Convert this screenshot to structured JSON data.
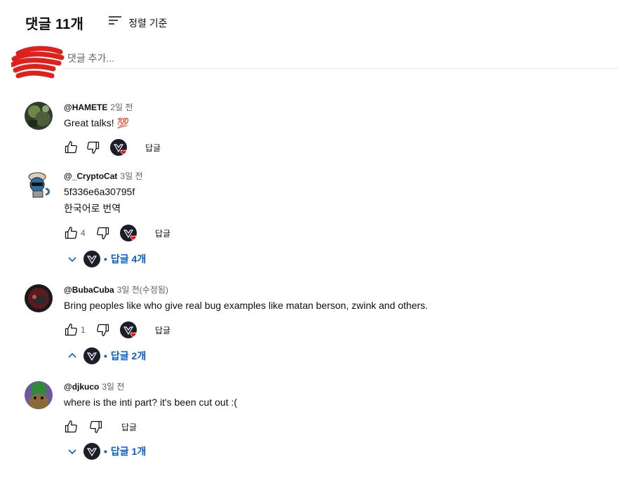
{
  "header": {
    "count_title": "댓글 11개",
    "sort_label": "정렬 기준"
  },
  "add_comment": {
    "placeholder": "댓글 추가..."
  },
  "comments": [
    {
      "author": "@HAMETE",
      "time": "2일 전",
      "text": "Great talks! 💯",
      "likes": "",
      "reply_label": "답글",
      "creator_heart": true,
      "replies_label": ""
    },
    {
      "author": "@_CryptoCat",
      "time": "3일 전",
      "text": "5f336e6a30795f",
      "translate_label": "한국어로 번역",
      "likes": "4",
      "reply_label": "답글",
      "creator_heart": true,
      "replies_label": "답글 4개"
    },
    {
      "author": "@BubaCuba",
      "time": "3일 전(수정됨)",
      "text": "Bring peoples like who give real bug examples like matan berson, zwink and others.",
      "likes": "1",
      "reply_label": "답글",
      "creator_heart": true,
      "replies_label": "답글 2개"
    },
    {
      "author": "@djkuco",
      "time": "3일 전",
      "text": "where is the inti part? it's been cut out :(",
      "likes": "",
      "reply_label": "답글",
      "creator_heart": false,
      "replies_label": "답글 1개"
    }
  ],
  "colors": {
    "link_blue": "#065fd4",
    "heart_red": "#ff0000",
    "creator_bg": "#1c1c2b",
    "redaction_red": "#e0201b"
  }
}
